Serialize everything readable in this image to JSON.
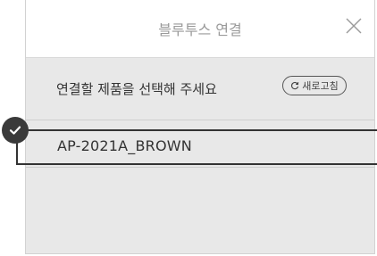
{
  "dialog": {
    "title": "블루투스 연결",
    "close_icon": "close-icon"
  },
  "instruction": {
    "text": "연결할 제품을 선택해 주세요",
    "refresh_label": "새로고침",
    "refresh_icon": "refresh-icon"
  },
  "devices": [
    {
      "name": "AP-2021A_BROWN",
      "selected": true
    }
  ],
  "colors": {
    "dialog_bg": "#e8e8e8",
    "header_bg": "#ffffff",
    "selection_border": "#333333",
    "check_badge": "#3a3a3a"
  }
}
